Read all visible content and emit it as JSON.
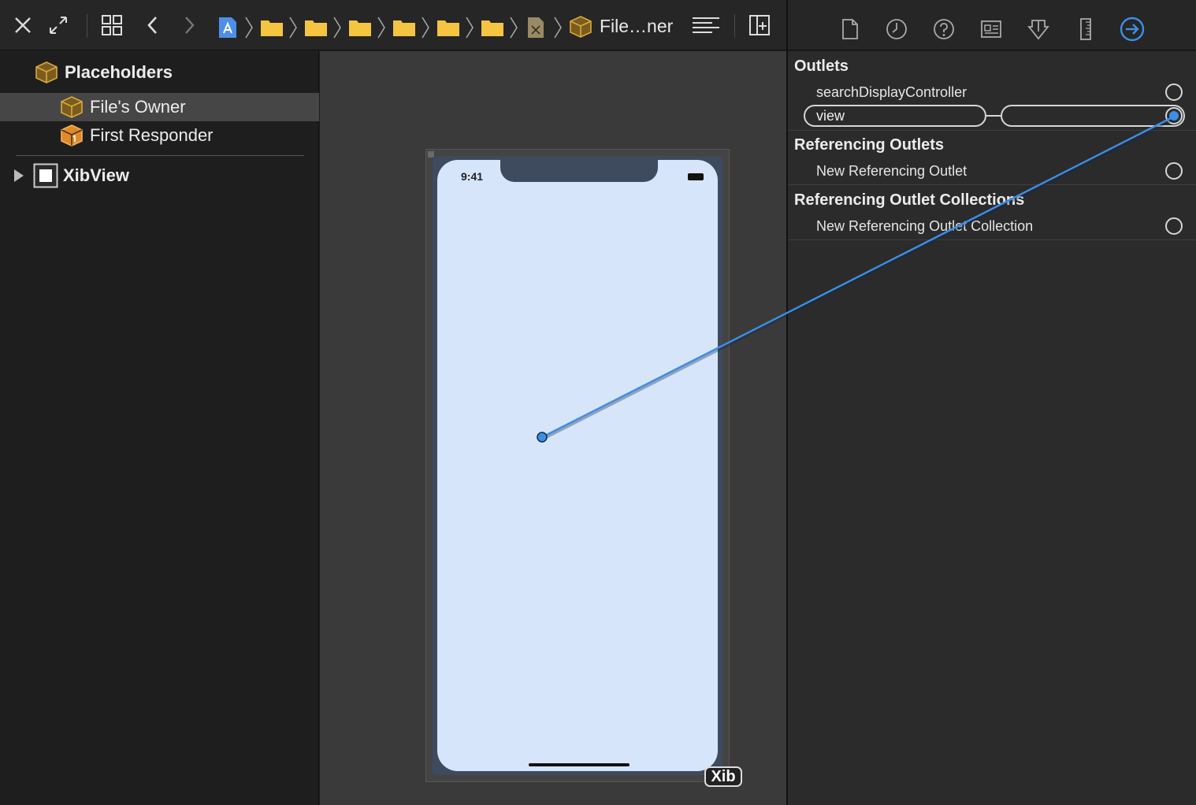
{
  "toolbar": {
    "breadcrumb_title": "File…ner",
    "icons": [
      "close-icon",
      "expand-icon",
      "related-items-icon",
      "back-icon",
      "forward-icon",
      "project-file-icon",
      "folder-icon",
      "xib-file-icon",
      "object-cube-icon",
      "editor-options-icon",
      "add-editor-icon"
    ]
  },
  "inspector_tabs": [
    "file-inspector-icon",
    "history-inspector-icon",
    "quick-help-icon",
    "identity-inspector-icon",
    "attributes-inspector-icon",
    "size-inspector-icon",
    "connections-inspector-icon"
  ],
  "outline": {
    "placeholders_label": "Placeholders",
    "items": [
      {
        "label": "File's Owner"
      },
      {
        "label": "First Responder"
      }
    ],
    "xibview_label": "XibView"
  },
  "canvas": {
    "status_time": "9:41",
    "badge": "Xib"
  },
  "inspector": {
    "outlets_title": "Outlets",
    "outlets": [
      {
        "label": "searchDisplayController"
      },
      {
        "label": "view"
      }
    ],
    "referencing_title": "Referencing Outlets",
    "referencing_item": "New Referencing Outlet",
    "collections_title": "Referencing Outlet Collections",
    "collections_item": "New Referencing Outlet Collection"
  },
  "colors": {
    "accent": "#3d8ee6",
    "cube": "#d9a93c",
    "screen": "#d7e5fb",
    "folder": "#f5c542"
  }
}
